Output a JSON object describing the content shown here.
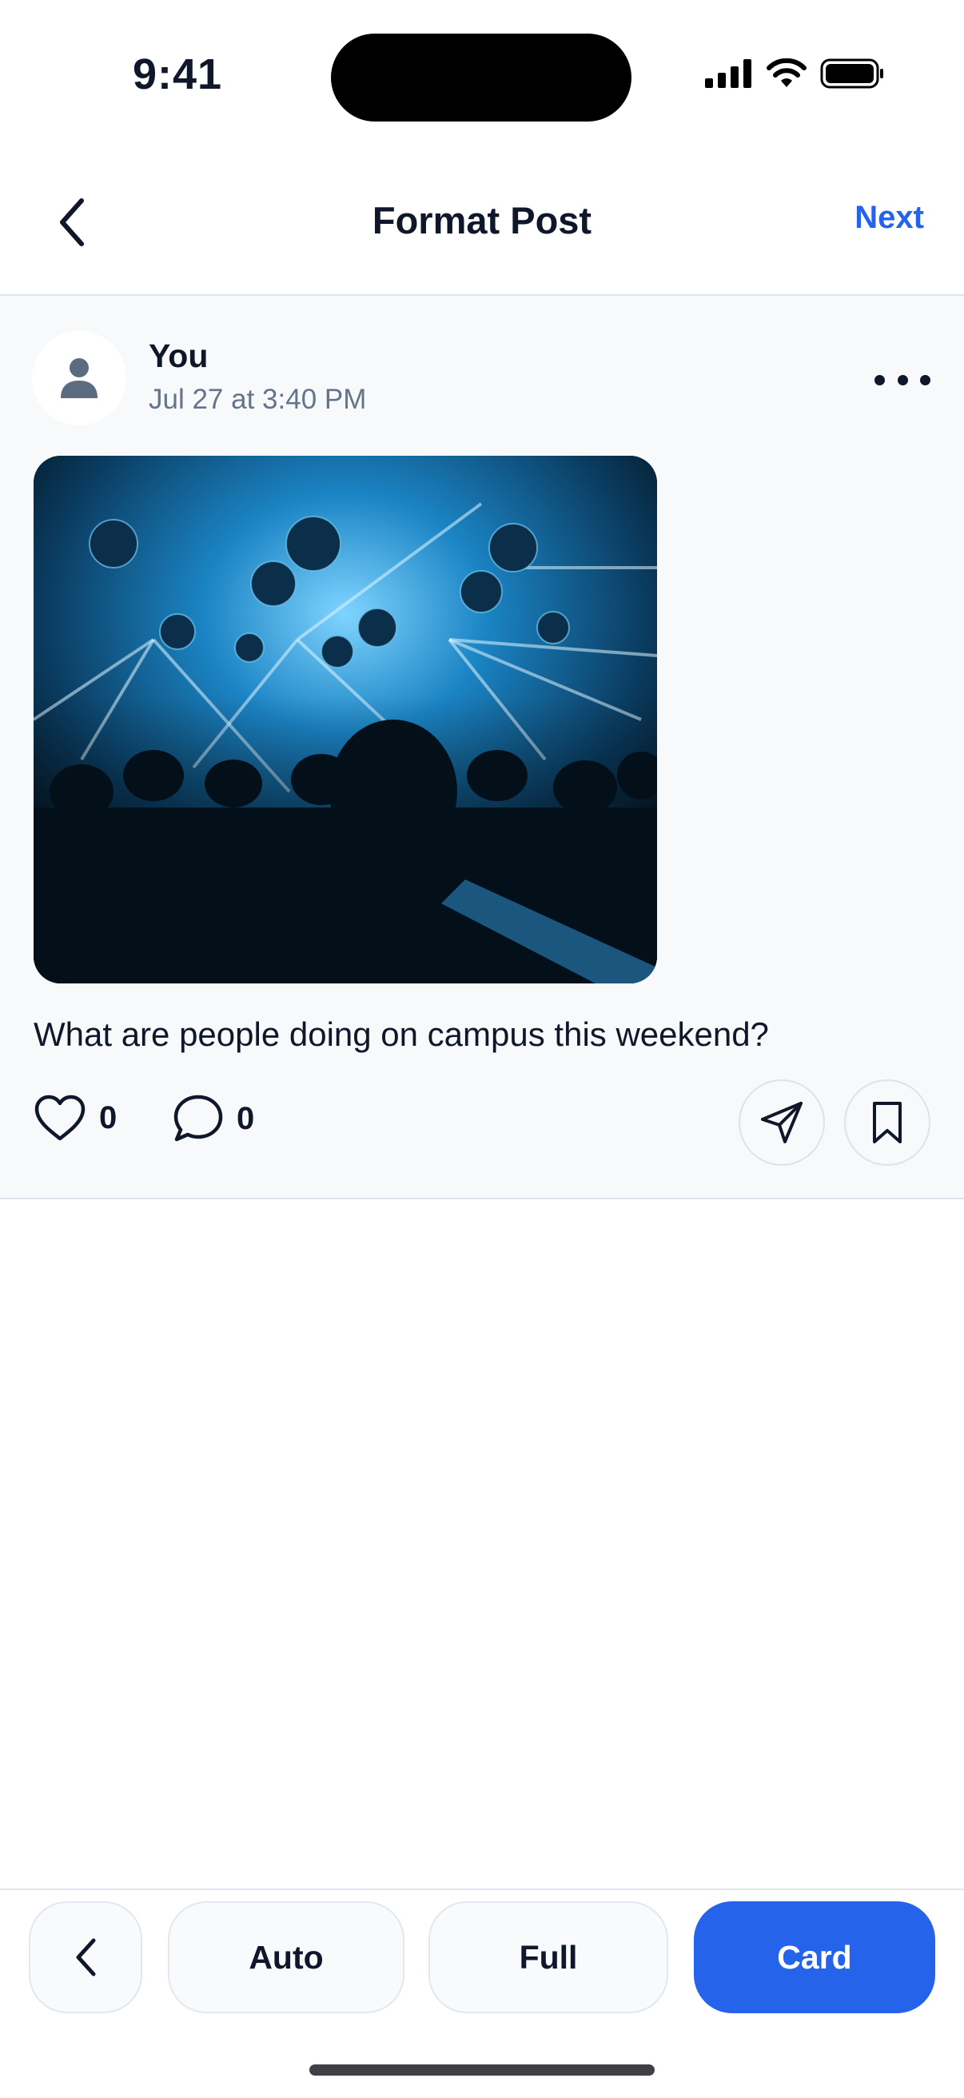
{
  "status_bar": {
    "time": "9:41"
  },
  "header": {
    "title": "Format Post",
    "next_label": "Next"
  },
  "post": {
    "author": "You",
    "timestamp": "Jul 27 at 3:40 PM",
    "caption": "What are people doing on campus this weekend?",
    "likes": "0",
    "comments": "0"
  },
  "toolbar": {
    "options": [
      "Auto",
      "Full",
      "Card"
    ],
    "selected": "Card"
  },
  "colors": {
    "accent": "#2563eb",
    "text": "#0f172a",
    "muted": "#64748b",
    "card_bg": "#f7f9fb",
    "border": "#dbe3ec"
  },
  "icons": [
    "back-chevron-icon",
    "cellular-signal-icon",
    "wifi-icon",
    "battery-icon",
    "person-icon",
    "more-horizontal-icon",
    "heart-icon",
    "comment-icon",
    "send-icon",
    "bookmark-icon"
  ]
}
